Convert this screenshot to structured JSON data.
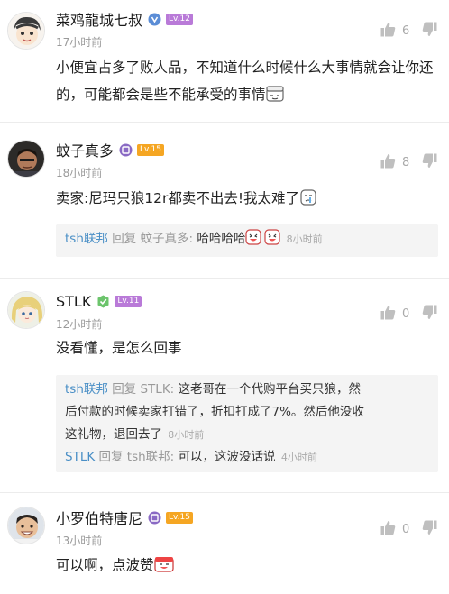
{
  "comments": [
    {
      "username": "菜鸡龍城七叔",
      "level": "Lv.12",
      "time": "17小时前",
      "likes": "6",
      "text": "小便宜占多了败人品，不知道什么时候什么大事情就会让你还的，可能都会是些不能承受的事情",
      "replies": []
    },
    {
      "username": "蚊子真多",
      "level": "Lv.15",
      "time": "18小时前",
      "likes": "8",
      "text": "卖家:尼玛只狼12r都卖不出去!我太难了",
      "replies": [
        {
          "from": "tsh联邦",
          "reply_word": "回复",
          "to": "蚊子真多:",
          "text": "哈哈哈哈",
          "time": "8小时前"
        }
      ]
    },
    {
      "username": "STLK",
      "level": "Lv.11",
      "time": "12小时前",
      "likes": "0",
      "text": "没看懂，是怎么回事",
      "replies": [
        {
          "from": "tsh联邦",
          "reply_word": "回复",
          "to": "STLK:",
          "text_lines": [
            "这老哥在一个代购平台买只狼，然",
            "后付款的时候卖家打错了，折扣打成了7%。然后他没收",
            "这礼物，退回去了"
          ],
          "time": "8小时前"
        },
        {
          "from": "STLK",
          "reply_word": "回复",
          "to": "tsh联邦:",
          "text": "可以，这波没话说",
          "time": "4小时前"
        }
      ]
    },
    {
      "username": "小罗伯特唐尼",
      "level": "Lv.15",
      "time": "13小时前",
      "likes": "0",
      "text": "可以啊，点波赞",
      "replies": []
    }
  ],
  "colors": {
    "link": "#4a8fc6",
    "level_purple": "#b97ad8",
    "level_orange": "#f5a623",
    "verified_blue": "#5b8dd6",
    "verified_green": "#6cc46c",
    "verified_purple": "#8a6ac4"
  }
}
